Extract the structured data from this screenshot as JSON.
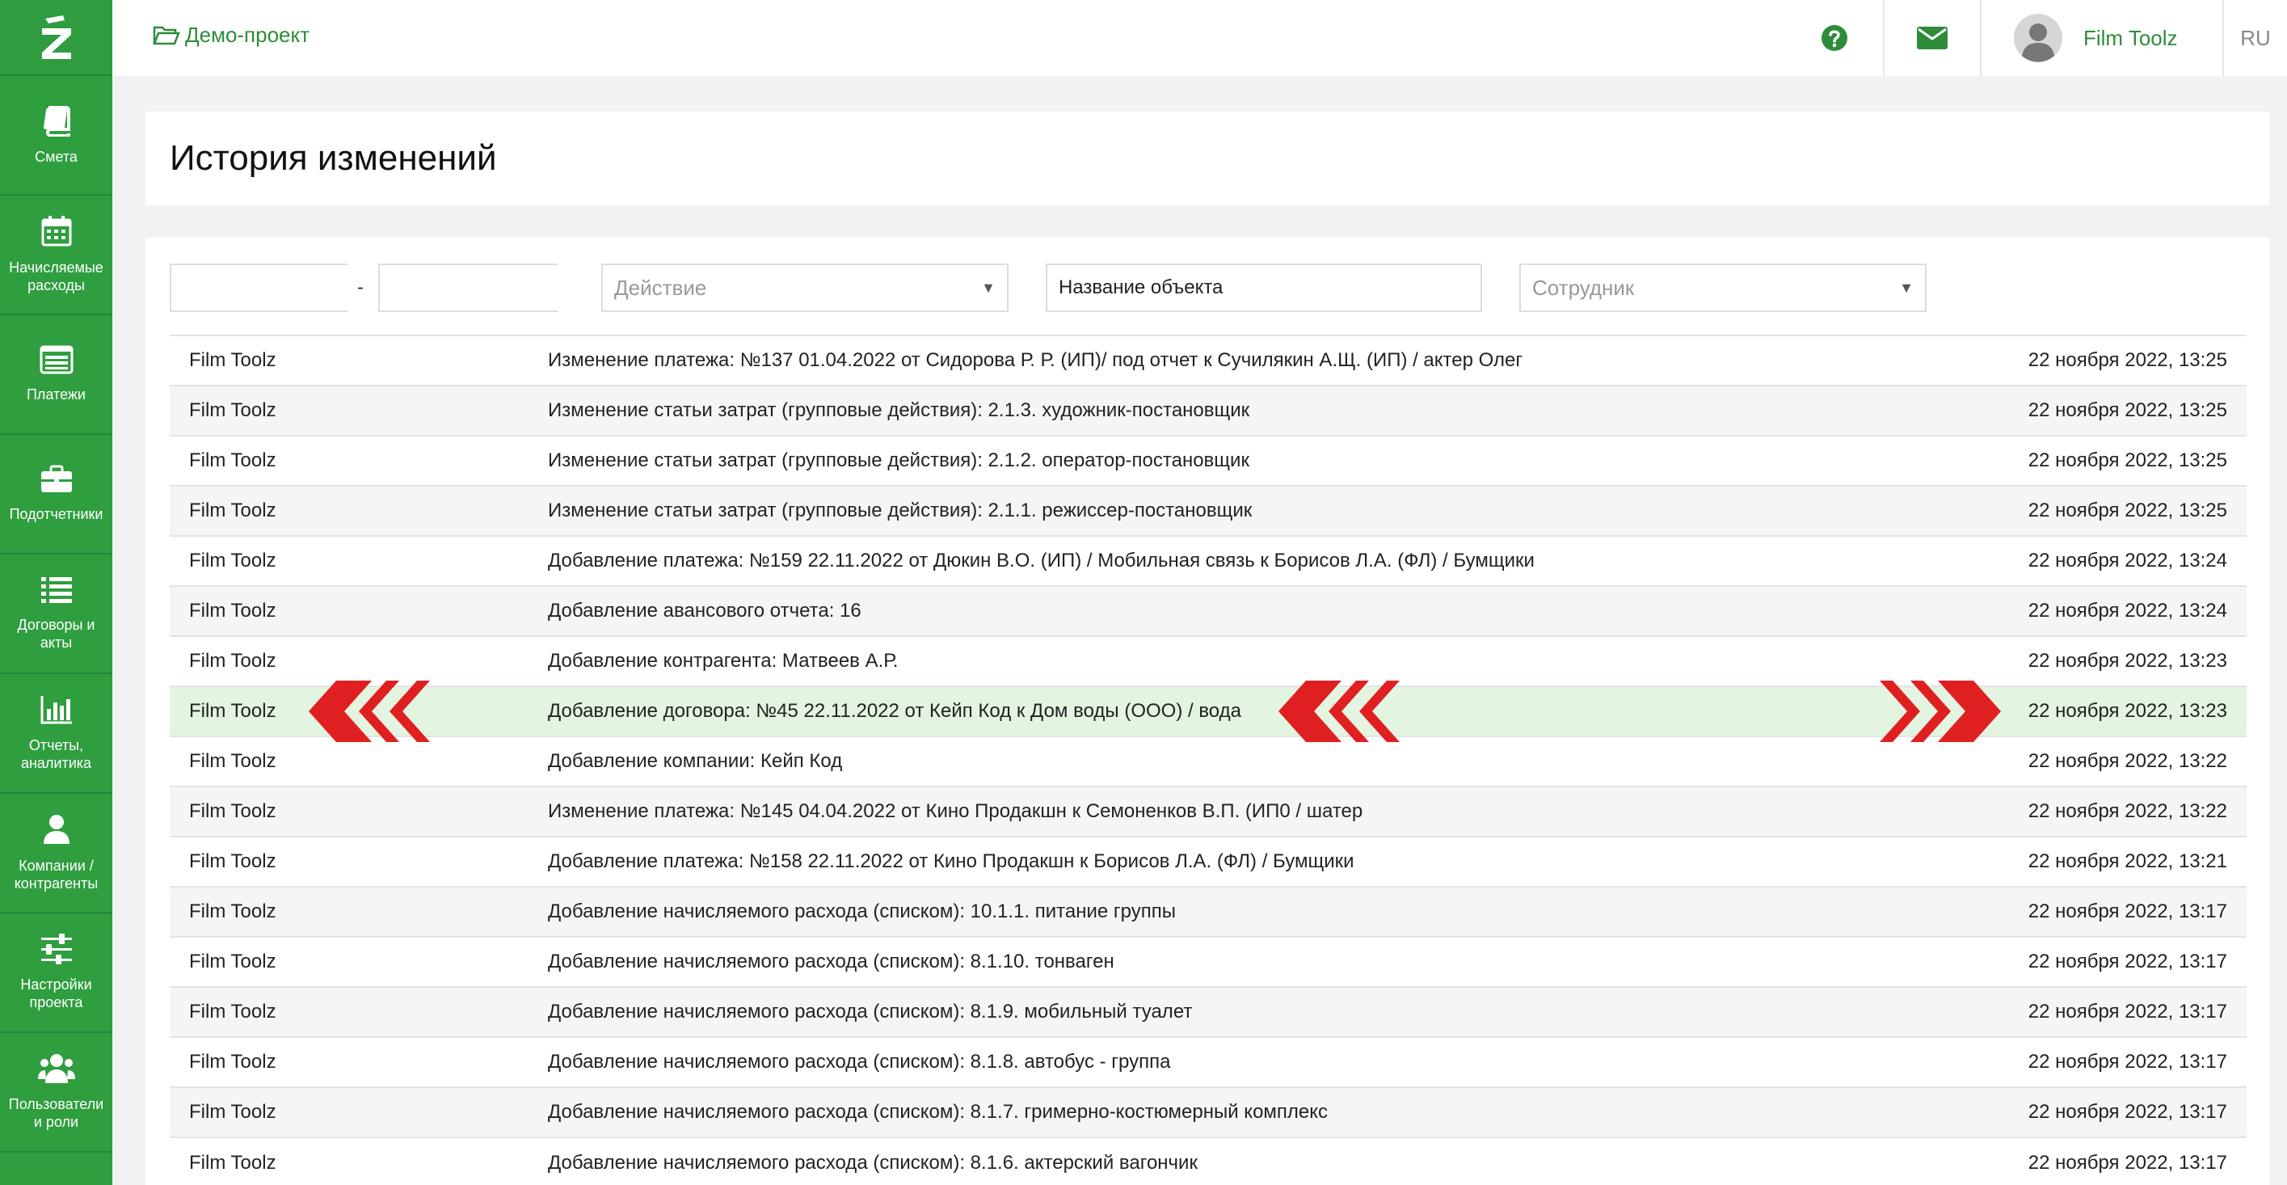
{
  "sidebar": {
    "items": [
      {
        "label": "Смета",
        "icon": "book-icon"
      },
      {
        "label": "Начисляемые расходы",
        "icon": "calendar-icon"
      },
      {
        "label": "Платежи",
        "icon": "list-card-icon"
      },
      {
        "label": "Подотчетники",
        "icon": "briefcase-icon"
      },
      {
        "label": "Договоры и акты",
        "icon": "list-icon"
      },
      {
        "label": "Отчеты, аналитика",
        "icon": "bar-chart-icon"
      },
      {
        "label": "Компании / контрагенты",
        "icon": "user-icon"
      },
      {
        "label": "Настройки проекта",
        "icon": "sliders-icon"
      },
      {
        "label": "Пользователи и роли",
        "icon": "users-icon"
      }
    ]
  },
  "header": {
    "project": "Демо-проект",
    "user_name": "Film Toolz",
    "language": "RU"
  },
  "page": {
    "title": "История изменений"
  },
  "filters": {
    "date_from": "",
    "date_to": "",
    "dash": "-",
    "action_placeholder": "Действие",
    "object_name_value": "Название объекта",
    "employee_placeholder": "Сотрудник"
  },
  "rows": [
    {
      "user": "Film Toolz",
      "action": "Изменение платежа: №137 01.04.2022 от Сидорова Р. Р. (ИП)/ под отчет к Сучилякин А.Щ. (ИП) / актер Олег",
      "date": "22 ноября 2022, 13:25"
    },
    {
      "user": "Film Toolz",
      "action": "Изменение статьи затрат (групповые действия): 2.1.3. художник-постановщик",
      "date": "22 ноября 2022, 13:25"
    },
    {
      "user": "Film Toolz",
      "action": "Изменение статьи затрат (групповые действия): 2.1.2. оператор-постановщик",
      "date": "22 ноября 2022, 13:25"
    },
    {
      "user": "Film Toolz",
      "action": "Изменение статьи затрат (групповые действия): 2.1.1. режиссер-постановщик",
      "date": "22 ноября 2022, 13:25"
    },
    {
      "user": "Film Toolz",
      "action": "Добавление платежа: №159 22.11.2022 от Дюкин В.О. (ИП) / Мобильная связь к Борисов Л.А. (ФЛ) / Бумщики",
      "date": "22 ноября 2022, 13:24"
    },
    {
      "user": "Film Toolz",
      "action": "Добавление авансового отчета: 16",
      "date": "22 ноября 2022, 13:24"
    },
    {
      "user": "Film Toolz",
      "action": "Добавление контрагента: Матвеев А.Р.",
      "date": "22 ноября 2022, 13:23"
    },
    {
      "user": "Film Toolz",
      "action": "Добавление договора: №45 22.11.2022 от Кейп Код к Дом воды (ООО) / вода",
      "date": "22 ноября 2022, 13:23"
    },
    {
      "user": "Film Toolz",
      "action": "Добавление компании: Кейп Код",
      "date": "22 ноября 2022, 13:22"
    },
    {
      "user": "Film Toolz",
      "action": "Изменение платежа: №145 04.04.2022 от Кино Продакшн к Семоненков В.П. (ИП0 / шатер",
      "date": "22 ноября 2022, 13:22"
    },
    {
      "user": "Film Toolz",
      "action": "Добавление платежа: №158 22.11.2022 от Кино Продакшн к Борисов Л.А. (ФЛ) / Бумщики",
      "date": "22 ноября 2022, 13:21"
    },
    {
      "user": "Film Toolz",
      "action": "Добавление начисляемого расхода (списком): 10.1.1. питание группы",
      "date": "22 ноября 2022, 13:17"
    },
    {
      "user": "Film Toolz",
      "action": "Добавление начисляемого расхода (списком): 8.1.10. тонваген",
      "date": "22 ноября 2022, 13:17"
    },
    {
      "user": "Film Toolz",
      "action": "Добавление начисляемого расхода (списком): 8.1.9. мобильный туалет",
      "date": "22 ноября 2022, 13:17"
    },
    {
      "user": "Film Toolz",
      "action": "Добавление начисляемого расхода (списком): 8.1.8. автобус - группа",
      "date": "22 ноября 2022, 13:17"
    },
    {
      "user": "Film Toolz",
      "action": "Добавление начисляемого расхода (списком): 8.1.7. гримерно-костюмерный комплекс",
      "date": "22 ноября 2022, 13:17"
    },
    {
      "user": "Film Toolz",
      "action": "Добавление начисляемого расхода (списком): 8.1.6. актерский вагончик",
      "date": "22 ноября 2022, 13:17"
    }
  ],
  "highlighted_row_index": 7,
  "colors": {
    "brand_green": "#2e9e3f",
    "link_green": "#2e8b3a",
    "highlight_row": "#e3f4e1",
    "marker_red": "#e02020"
  }
}
